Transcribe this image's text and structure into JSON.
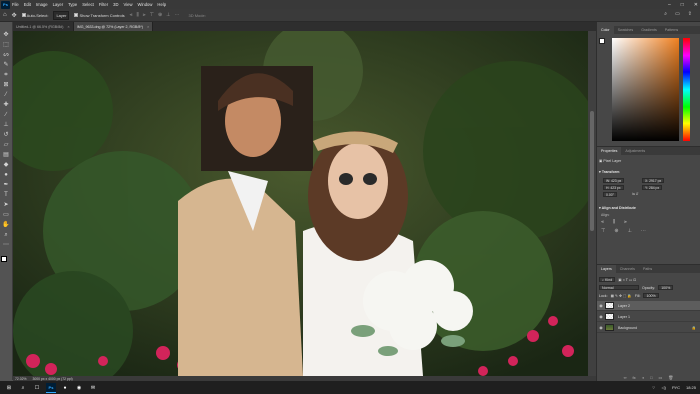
{
  "app": {
    "logo": "Ps",
    "menu": [
      "File",
      "Edit",
      "Image",
      "Layer",
      "Type",
      "Select",
      "Filter",
      "3D",
      "View",
      "Window",
      "Help"
    ],
    "window_controls": [
      "–",
      "□",
      "✕"
    ]
  },
  "options": {
    "auto_select_label": "Auto-Select:",
    "auto_select_value": "Layer",
    "transform_label": "Show Transform Controls",
    "mode_3d": "3D Mode:",
    "right_icons": [
      "⌕",
      "▭",
      "⇪"
    ]
  },
  "tabs": [
    {
      "label": "Untitled-1 @ 66.5% (RGB/8#)",
      "active": false
    },
    {
      "label": "IMG_9633.dng @ 72% (Layer 2, RGB/8*)",
      "active": true
    }
  ],
  "tools": [
    {
      "name": "move-tool",
      "glyph": "✥"
    },
    {
      "name": "marquee-tool",
      "glyph": "⬚"
    },
    {
      "name": "lasso-tool",
      "glyph": "ᔕ"
    },
    {
      "name": "quick-select-tool",
      "glyph": "✎"
    },
    {
      "name": "crop-tool",
      "glyph": "⌗"
    },
    {
      "name": "frame-tool",
      "glyph": "⊠"
    },
    {
      "name": "eyedropper-tool",
      "glyph": "⁄"
    },
    {
      "name": "healing-tool",
      "glyph": "✚"
    },
    {
      "name": "brush-tool",
      "glyph": "∕"
    },
    {
      "name": "stamp-tool",
      "glyph": "⊥"
    },
    {
      "name": "history-brush-tool",
      "glyph": "↺"
    },
    {
      "name": "eraser-tool",
      "glyph": "▱"
    },
    {
      "name": "gradient-tool",
      "glyph": "▤"
    },
    {
      "name": "blur-tool",
      "glyph": "◆"
    },
    {
      "name": "dodge-tool",
      "glyph": "●"
    },
    {
      "name": "pen-tool",
      "glyph": "✒"
    },
    {
      "name": "type-tool",
      "glyph": "T"
    },
    {
      "name": "path-select-tool",
      "glyph": "➤"
    },
    {
      "name": "shape-tool",
      "glyph": "▭"
    },
    {
      "name": "hand-tool",
      "glyph": "✋"
    },
    {
      "name": "zoom-tool",
      "glyph": "⌕"
    },
    {
      "name": "more-tools",
      "glyph": "⋯"
    }
  ],
  "status": {
    "zoom": "72.02%",
    "doc_size": "3000 px x 4000 px (72 ppi)"
  },
  "color_panel": {
    "tabs": [
      "Color",
      "Swatches",
      "Gradients",
      "Patterns"
    ]
  },
  "properties": {
    "tabs": [
      "Properties",
      "Adjustments"
    ],
    "layer_kind": "Pixel Layer",
    "transform_title": "Transform",
    "w": "W: 423 px",
    "h": "H: 423 px",
    "x": "X: 2917 px",
    "y": "Y: 284 px",
    "angle": "0.00°",
    "align_title": "Align and Distribute",
    "align_label": "Align:"
  },
  "layers": {
    "tabs": [
      "Layers",
      "Channels",
      "Paths"
    ],
    "kind_filter": "Kind",
    "blend_mode": "Normal",
    "opacity_label": "Opacity:",
    "opacity_value": "100%",
    "lock_label": "Lock:",
    "fill_label": "Fill:",
    "fill_value": "100%",
    "items": [
      {
        "name": "Layer 2",
        "selected": true
      },
      {
        "name": "Layer 1",
        "selected": false
      },
      {
        "name": "Background",
        "selected": false
      }
    ],
    "footer_icons": [
      "∞",
      "fx",
      "◑",
      "□",
      "▭",
      "🗑"
    ]
  },
  "taskbar": {
    "icons": [
      "⊞",
      "⌕",
      "☐",
      "Ps",
      "●",
      "◉",
      "✉"
    ],
    "tray_lang": "РУС",
    "tray_time": "18:25"
  }
}
